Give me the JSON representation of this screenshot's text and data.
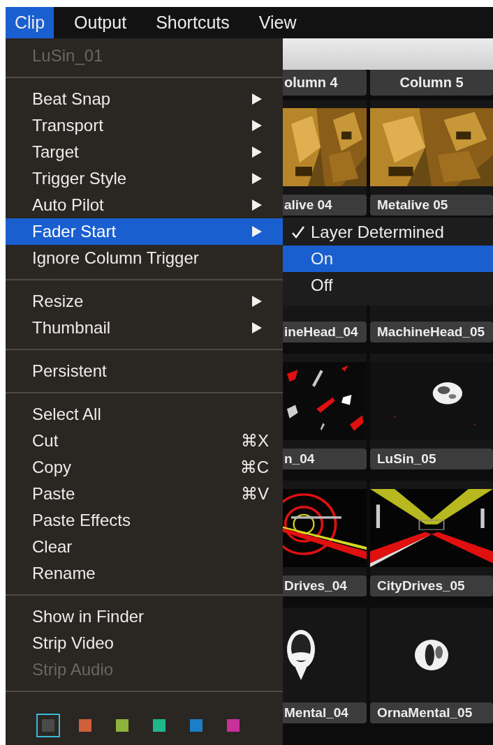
{
  "menu_bar": [
    {
      "label": "Clip",
      "selected": true
    },
    {
      "label": "Output",
      "selected": false
    },
    {
      "label": "Shortcuts",
      "selected": false
    },
    {
      "label": "View",
      "selected": false
    }
  ],
  "background": {
    "columns": [
      {
        "header": "olumn 4",
        "clips": [
          "alive 04",
          "ineHead_04",
          "n_04",
          "Drives_04",
          "Mental_04"
        ]
      },
      {
        "header": "Column 5",
        "clips": [
          "Metalive 05",
          "MachineHead_05",
          "LuSin_05",
          "CityDrives_05",
          "OrnaMental_05"
        ]
      }
    ]
  },
  "menu": {
    "title": "LuSin_01",
    "sections": [
      [
        {
          "label": "Beat Snap",
          "kind": "submenu",
          "selected": false,
          "disabled": false
        },
        {
          "label": "Transport",
          "kind": "submenu",
          "selected": false,
          "disabled": false
        },
        {
          "label": "Target",
          "kind": "submenu",
          "selected": false,
          "disabled": false
        },
        {
          "label": "Trigger Style",
          "kind": "submenu",
          "selected": false,
          "disabled": false
        },
        {
          "label": "Auto Pilot",
          "kind": "submenu",
          "selected": false,
          "disabled": false
        },
        {
          "label": "Fader Start",
          "kind": "submenu",
          "selected": true,
          "disabled": false
        },
        {
          "label": "Ignore Column Trigger",
          "kind": "action",
          "selected": false,
          "disabled": false
        }
      ],
      [
        {
          "label": "Resize",
          "kind": "submenu",
          "selected": false,
          "disabled": false
        },
        {
          "label": "Thumbnail",
          "kind": "submenu",
          "selected": false,
          "disabled": false
        }
      ],
      [
        {
          "label": "Persistent",
          "kind": "action",
          "selected": false,
          "disabled": false
        }
      ],
      [
        {
          "label": "Select All",
          "kind": "action",
          "selected": false,
          "disabled": false
        },
        {
          "label": "Cut",
          "kind": "action",
          "shortcut": "⌘X",
          "selected": false,
          "disabled": false
        },
        {
          "label": "Copy",
          "kind": "action",
          "shortcut": "⌘C",
          "selected": false,
          "disabled": false
        },
        {
          "label": "Paste",
          "kind": "action",
          "shortcut": "⌘V",
          "selected": false,
          "disabled": false
        },
        {
          "label": "Paste Effects",
          "kind": "action",
          "selected": false,
          "disabled": false
        },
        {
          "label": "Clear",
          "kind": "action",
          "selected": false,
          "disabled": false
        },
        {
          "label": "Rename",
          "kind": "action",
          "selected": false,
          "disabled": false
        }
      ],
      [
        {
          "label": "Show in Finder",
          "kind": "action",
          "selected": false,
          "disabled": false
        },
        {
          "label": "Strip Video",
          "kind": "action",
          "selected": false,
          "disabled": false
        },
        {
          "label": "Strip Audio",
          "kind": "action",
          "selected": false,
          "disabled": true
        }
      ]
    ],
    "swatches": [
      {
        "color": "#4a4a4a",
        "selected": true
      },
      {
        "color": "#d0603a",
        "selected": false
      },
      {
        "color": "#8cb33a",
        "selected": false
      },
      {
        "color": "#1fb88a",
        "selected": false
      },
      {
        "color": "#1a7fc8",
        "selected": false
      },
      {
        "color": "#c8309a",
        "selected": false
      }
    ]
  },
  "submenu": {
    "items": [
      {
        "label": "Layer Determined",
        "checked": true,
        "selected": false
      },
      {
        "label": "On",
        "checked": false,
        "selected": true
      },
      {
        "label": "Off",
        "checked": false,
        "selected": false
      }
    ]
  }
}
